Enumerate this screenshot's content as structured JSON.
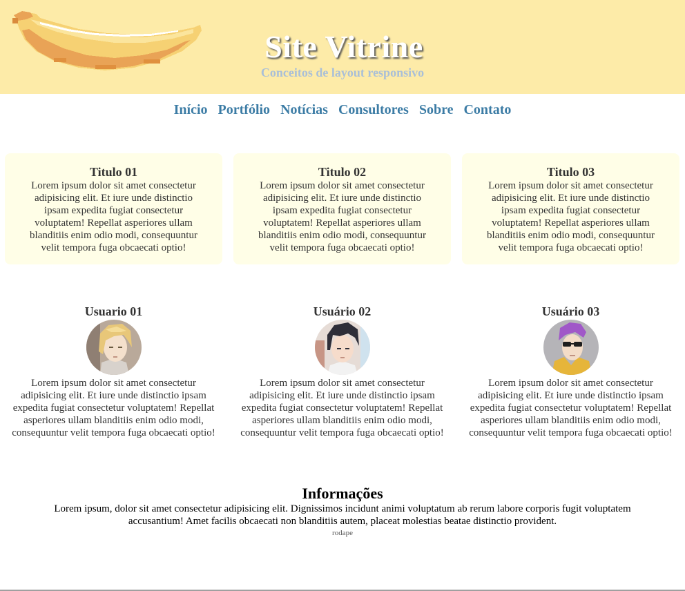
{
  "header": {
    "title": "Site Vitrine",
    "subtitle": "Conceitos de layout responsivo",
    "background_color": "#fdeba8",
    "logo_icon": "banana-icon"
  },
  "nav": {
    "items": [
      "Início",
      "Portfólio",
      "Notícias",
      "Consultores",
      "Sobre",
      "Contato"
    ],
    "color": "#3c7ca5"
  },
  "cards": [
    {
      "title": "Titulo 01",
      "text": "Lorem ipsum dolor sit amet consectetur adipisicing elit. Et iure unde distinctio ipsam expedita fugiat consectetur voluptatem! Repellat asperiores ullam blanditiis enim odio modi, consequuntur velit tempora fuga obcaecati optio!"
    },
    {
      "title": "Titulo 02",
      "text": "Lorem ipsum dolor sit amet consectetur adipisicing elit. Et iure unde distinctio ipsam expedita fugiat consectetur voluptatem! Repellat asperiores ullam blanditiis enim odio modi, consequuntur velit tempora fuga obcaecati optio!"
    },
    {
      "title": "Titulo 03",
      "text": "Lorem ipsum dolor sit amet consectetur adipisicing elit. Et iure unde distinctio ipsam expedita fugiat consectetur voluptatem! Repellat asperiores ullam blanditiis enim odio modi, consequuntur velit tempora fuga obcaecati optio!"
    }
  ],
  "users": [
    {
      "name": "Usuario 01",
      "avatar_icon": "blonde-man-avatar-icon",
      "text": "Lorem ipsum dolor sit amet consectetur adipisicing elit. Et iure unde distinctio ipsam expedita fugiat consectetur voluptatem! Repellat asperiores ullam blanditiis enim odio modi, consequuntur velit tempora fuga obcaecati optio!"
    },
    {
      "name": "Usuário 02",
      "avatar_icon": "dark-hair-man-avatar-icon",
      "text": "Lorem ipsum dolor sit amet consectetur adipisicing elit. Et iure unde distinctio ipsam expedita fugiat consectetur voluptatem! Repellat asperiores ullam blanditiis enim odio modi, consequuntur velit tempora fuga obcaecati optio!"
    },
    {
      "name": "Usuário 03",
      "avatar_icon": "purple-hair-sunglasses-avatar-icon",
      "text": "Lorem ipsum dolor sit amet consectetur adipisicing elit. Et iure unde distinctio ipsam expedita fugiat consectetur voluptatem! Repellat asperiores ullam blanditiis enim odio modi, consequuntur velit tempora fuga obcaecati optio!"
    }
  ],
  "info": {
    "title": "Informações",
    "text": "Lorem ipsum, dolor sit amet consectetur adipisicing elit. Dignissimos incidunt animi voluptatum ab rerum labore corporis fugit voluptatem accusantium! Amet facilis obcaecati non blanditiis autem, placeat molestias beatae distinctio provident.",
    "footer": "rodape"
  },
  "colors": {
    "card_background": "#fffee7",
    "text": "#333333"
  }
}
